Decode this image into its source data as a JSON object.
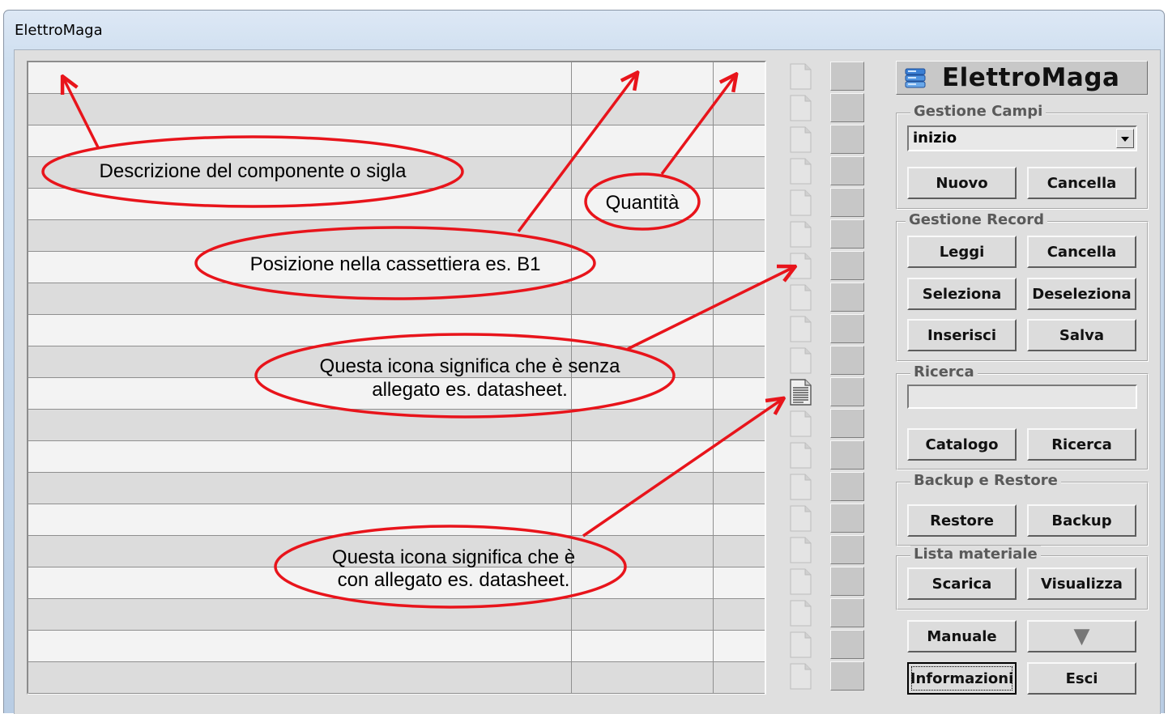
{
  "window": {
    "title": "ElettroMaga"
  },
  "grid": {
    "row_count": 20
  },
  "attachment_rows": [
    10
  ],
  "panel": {
    "brand": "ElettroMaga",
    "gestione_campi": {
      "legend": "Gestione Campi",
      "select_value": "inizio",
      "nuovo": "Nuovo",
      "cancella": "Cancella"
    },
    "gestione_record": {
      "legend": "Gestione Record",
      "leggi": "Leggi",
      "cancella": "Cancella",
      "seleziona": "Seleziona",
      "deseleziona": "Deseleziona",
      "inserisci": "Inserisci",
      "salva": "Salva"
    },
    "ricerca": {
      "legend": "Ricerca",
      "catalogo": "Catalogo",
      "ricerca": "Ricerca"
    },
    "backup": {
      "legend": "Backup e Restore",
      "restore": "Restore",
      "backup": "Backup"
    },
    "lista": {
      "legend": "Lista materiale",
      "scarica": "Scarica",
      "visualizza": "Visualizza"
    },
    "manuale": "Manuale",
    "down_arrow": "▼",
    "informazioni": "Informazioni",
    "esci": "Esci"
  },
  "annotations": {
    "descrizione": "Descrizione del componente o sigla",
    "quantita": "Quantità",
    "posizione": "Posizione nella cassettiera es. B1",
    "senza_1": "Questa icona significa che è senza",
    "senza_2": "allegato es. datasheet.",
    "con_1": "Questa icona significa che è",
    "con_2": "con allegato es. datasheet."
  },
  "colors": {
    "annotation": "#e8141b",
    "panel_bg": "#dfdfdf"
  }
}
